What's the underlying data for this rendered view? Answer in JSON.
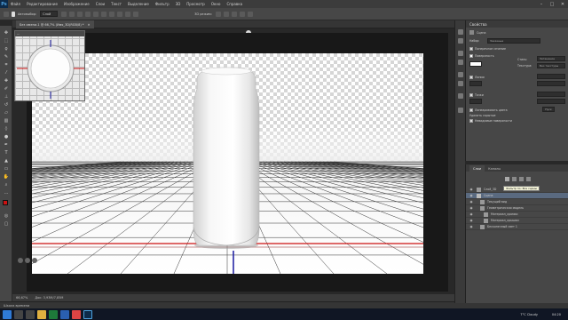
{
  "app": {
    "logo": "Ps"
  },
  "menu": [
    "Файл",
    "Редактирование",
    "Изображение",
    "Слои",
    "Текст",
    "Выделение",
    "Фильтр",
    "3D",
    "Просмотр",
    "Окно",
    "Справка"
  ],
  "options": {
    "autoselect": "Автовыбор:",
    "layer_select": "Слой",
    "mode_3d": "3D режим:"
  },
  "document": {
    "tab": "Без имени-1 @ 66,7% (Имя_3D(RGB/8) *"
  },
  "navigator": {
    "title": "..."
  },
  "status": {
    "zoom": "66,67%",
    "doc": "Док: 3,93M/7,85M"
  },
  "timeline": {
    "label": "Шкала времени"
  },
  "properties": {
    "title": "Свойства",
    "type": "Сцена",
    "preset_label": "Набор:",
    "preset_value": "Заказные",
    "cross_section": "Поперечное сечение",
    "surface": "Поверхность",
    "style_label": "Стиль:",
    "style_value": "Затенение",
    "texture_label": "Текстура:",
    "texture_value": "Без текстуры",
    "lines": "Линии",
    "points": "Точки",
    "linearize": "Линеаризовать цвета",
    "remove_hidden": "Удалить скрытые",
    "backfaces": "Невидимые поверхности",
    "render_btn": "Пуск"
  },
  "layers": {
    "tabs": [
      "Слои",
      "Каналы"
    ],
    "rows": [
      {
        "name": "Слой_3D"
      },
      {
        "name": "Сцена"
      },
      {
        "name": "Текущий вид"
      },
      {
        "name": "Геометрическая модель"
      },
      {
        "name": "Материал_кромки"
      },
      {
        "name": "Материал_крышки"
      },
      {
        "name": "Бесконечный свет 1"
      }
    ],
    "tooltip": "Фильтр по: Все сцены"
  },
  "taskbar": {
    "weather": "7°C Cloudy",
    "time": "04:20"
  },
  "colors": {
    "accent_red": "#cc1111",
    "accent_blue": "#1a1aa0",
    "ui_dark": "#474747"
  }
}
